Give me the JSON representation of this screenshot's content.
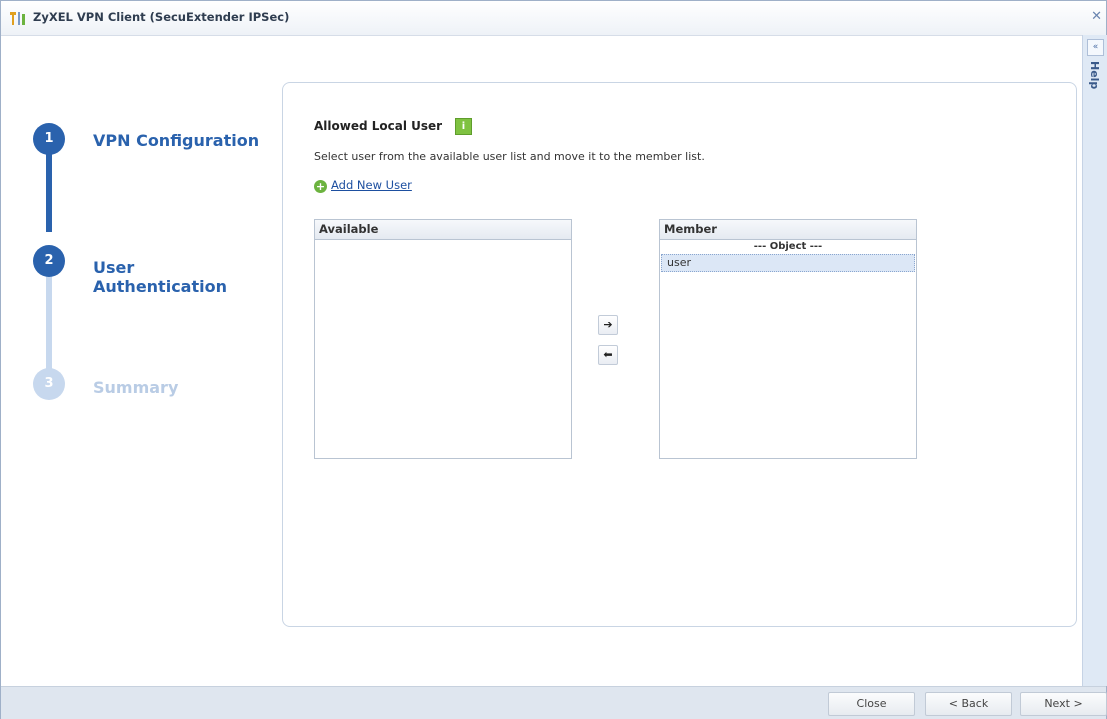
{
  "window": {
    "title": "ZyXEL VPN Client (SecuExtender IPSec)"
  },
  "help": {
    "label": "Help",
    "toggle": "«"
  },
  "steps": [
    {
      "number": "1",
      "label": "VPN Configuration",
      "state": "done"
    },
    {
      "number": "2",
      "label": "User Authentication",
      "state": "active"
    },
    {
      "number": "3",
      "label": "Summary",
      "state": "pending"
    }
  ],
  "panel": {
    "section_title": "Allowed Local User",
    "info_icon": "i",
    "instruction": "Select user from the available user list and move it to the member list.",
    "add_user_label": "Add New User",
    "available": {
      "header": "Available",
      "items": []
    },
    "member": {
      "header": "Member",
      "group_label": "--- Object ---",
      "items": [
        "user"
      ]
    },
    "move_right": "➔",
    "move_left": "⬅"
  },
  "footer": {
    "close": "Close",
    "back": "< Back",
    "next": "Next >"
  },
  "colors": {
    "accent": "#2a62ad",
    "inactive": "#c7d8ee",
    "info": "#7fc241"
  }
}
